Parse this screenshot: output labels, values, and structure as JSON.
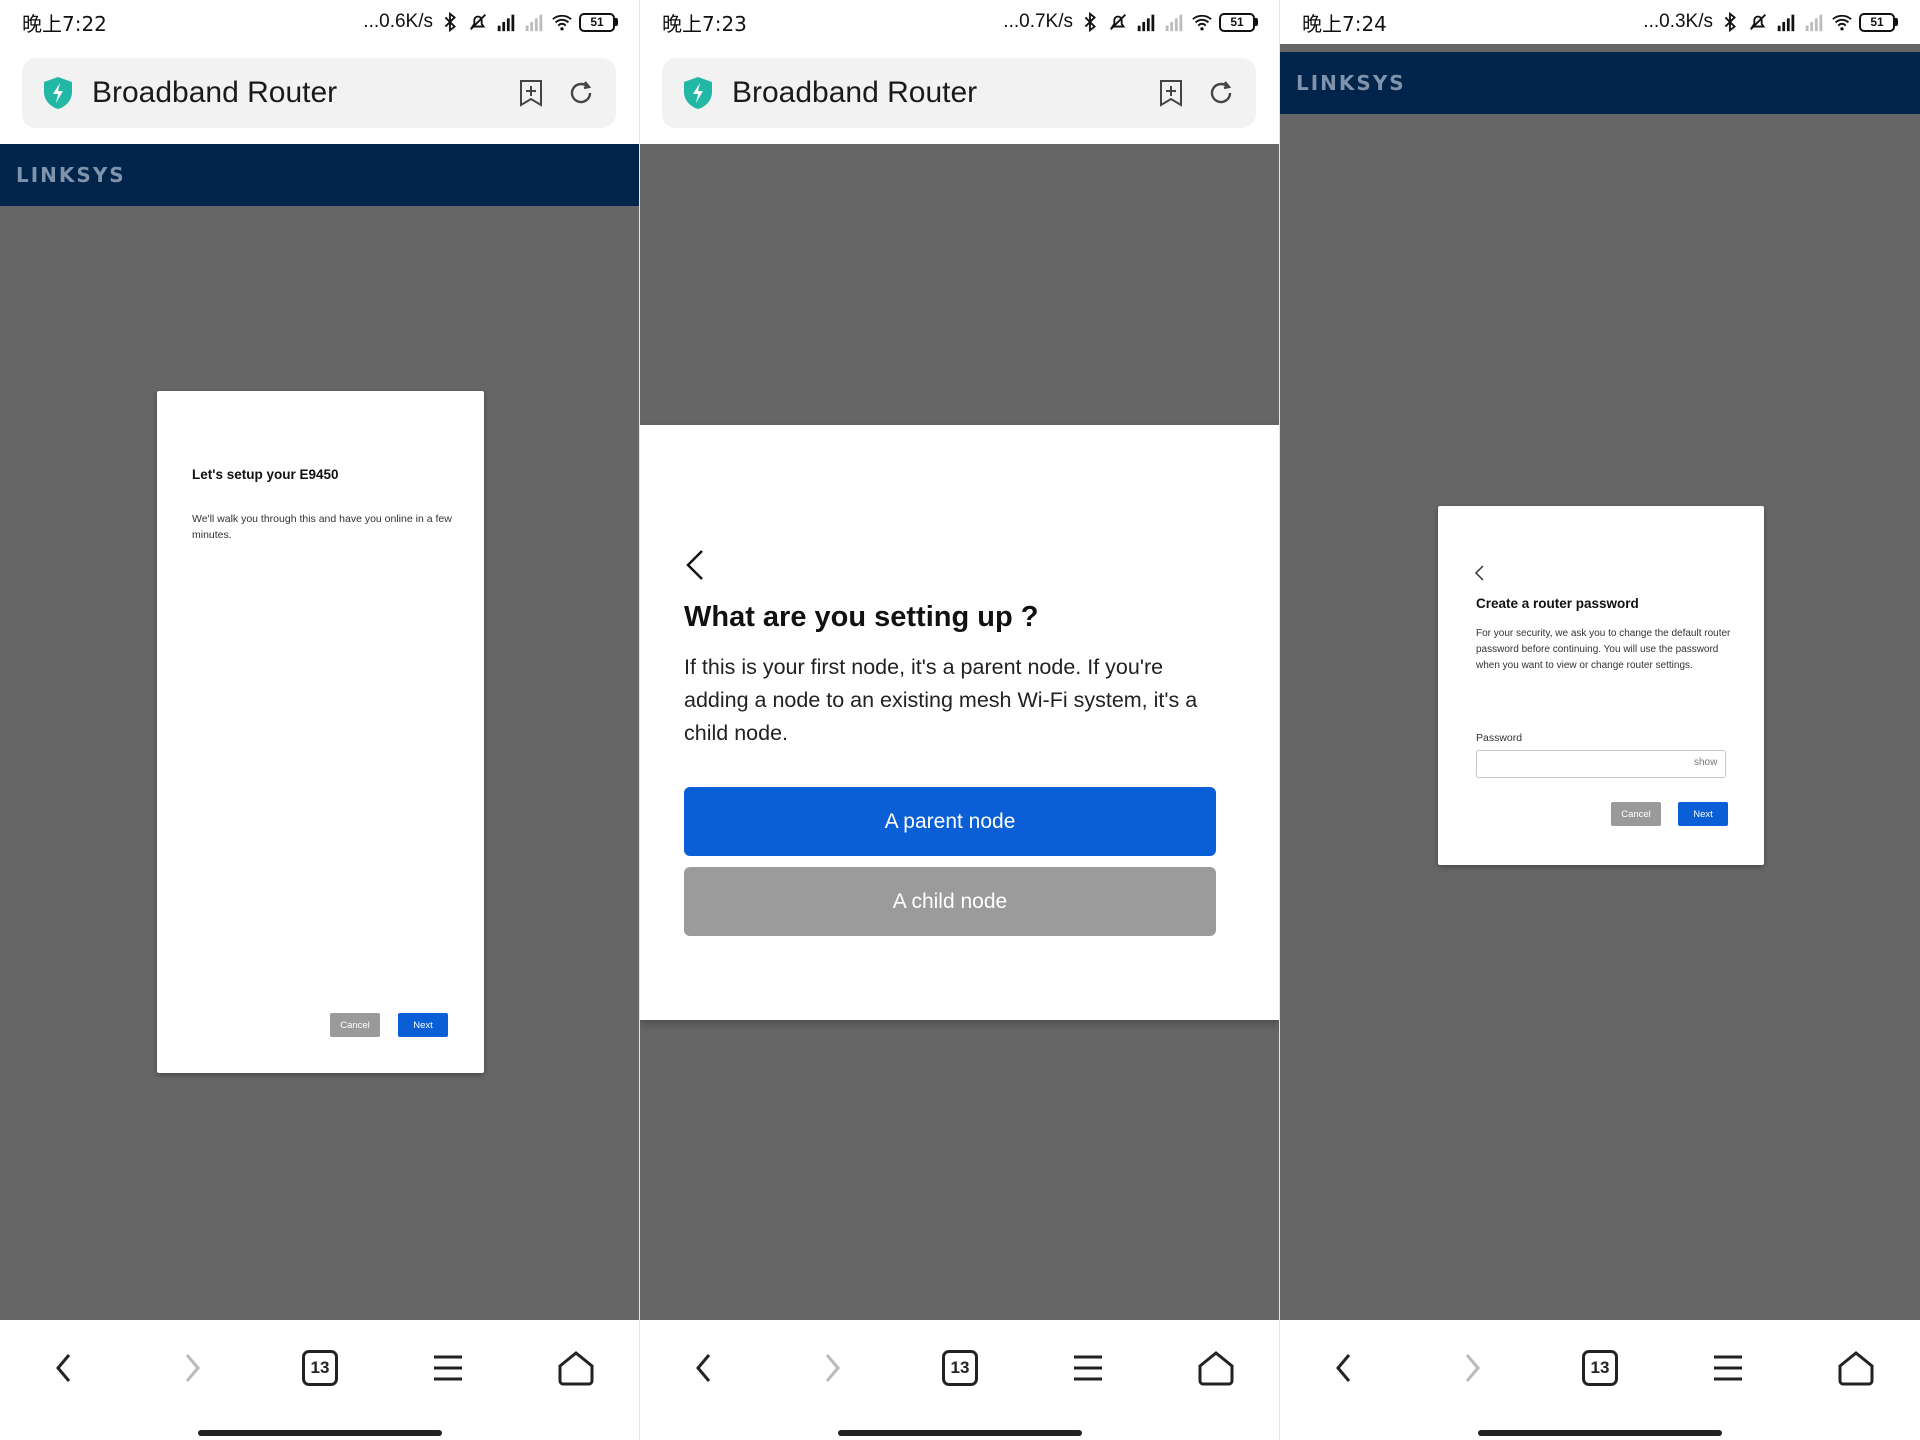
{
  "colors": {
    "accent_blue": "#0a5fd6",
    "linksys_header": "#00244a",
    "backdrop_gray": "#666666",
    "secondary_button": "#9b9b9b"
  },
  "panels": [
    {
      "status": {
        "time": "晚上7:22",
        "speed": "...0.6K/s",
        "battery": "51"
      },
      "browser": {
        "title": "Broadband Router",
        "site_icon": "shield-icon",
        "tab_count": "13"
      },
      "brand": "LINKSYS",
      "dialog": {
        "title": "Let's setup your E9450",
        "description": "We'll walk you through this and have you online in a few minutes.",
        "cancel_label": "Cancel",
        "next_label": "Next"
      }
    },
    {
      "status": {
        "time": "晚上7:23",
        "speed": "...0.7K/s",
        "battery": "51"
      },
      "browser": {
        "title": "Broadband Router",
        "site_icon": "shield-icon",
        "tab_count": "13"
      },
      "dialog": {
        "title": "What are you setting up ?",
        "description": "If this is your first node, it's a parent node. If you're adding a node to an existing mesh Wi-Fi system, it's a child node.",
        "parent_label": "A parent node",
        "child_label": "A child node"
      }
    },
    {
      "status": {
        "time": "晚上7:24",
        "speed": "...0.3K/s",
        "battery": "51"
      },
      "browser": {
        "tab_count": "13"
      },
      "brand": "LINKSYS",
      "dialog": {
        "title": "Create a router password",
        "description": "For your security, we ask you to change the default router password before continuing. You will use the password when you want to view or change router settings.",
        "password_label": "Password",
        "password_value": "",
        "show_label": "show",
        "cancel_label": "Cancel",
        "next_label": "Next"
      }
    }
  ]
}
